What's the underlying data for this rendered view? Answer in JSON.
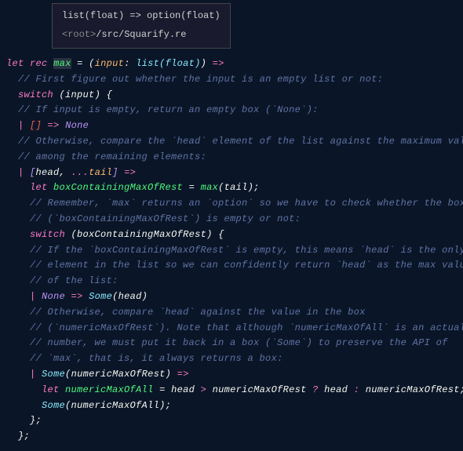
{
  "tooltip": {
    "type_sig": "list(float) => option(float)",
    "path_prefix": "<root>",
    "path": "/src/Squarify.re"
  },
  "code": {
    "l1": {
      "let": "let",
      "rec": "rec",
      "fn": "max",
      "eq": " = (",
      "input": "input",
      "colon": ": ",
      "type": "list(float)",
      "close": ")",
      "arrow": " =>"
    },
    "l2": "// First figure out whether the input is an empty list or not:",
    "l3": {
      "switch": "switch",
      "open": " (",
      "input": "input",
      "close": ") {"
    },
    "l4": "// If input is empty, return an empty box (`None`):",
    "l5": {
      "pipe": "|",
      "empty": " []",
      "arrow": " => ",
      "none": "None"
    },
    "l6": "// Otherwise, compare the `head` element of the list against the maximum value",
    "l7": "// among the remaining elements:",
    "l8": {
      "pipe": "|",
      "ob": " [",
      "head": "head",
      "comma": ", ",
      "spread": "...",
      "tail": "tail",
      "cb": "]",
      "arrow": " =>"
    },
    "l9": {
      "let": "let",
      "var": " boxContainingMaxOfRest",
      "eq": " = ",
      "call": "max",
      "open": "(",
      "arg": "tail",
      "close": ");"
    },
    "l10": "// Remember, `max` returns an `option` so we have to check whether the box",
    "l11": "// (`boxContainingMaxOfRest`) is empty or not:",
    "l12": {
      "switch": "switch",
      "open": " (",
      "var": "boxContainingMaxOfRest",
      "close": ") {"
    },
    "l13": "// If the `boxContainingMaxOfRest` is empty, this means `head` is the only",
    "l14": "// element in the list so we can confidently return `head` as the max value",
    "l15": "// of the list:",
    "l16": {
      "pipe": "|",
      "none": " None",
      "arrow": " => ",
      "some": "Some",
      "open": "(",
      "arg": "head",
      "close": ")"
    },
    "l17": "// Otherwise, compare `head` against the value in the box",
    "l18": "// (`numericMaxOfRest`). Note that although `numericMaxOfAll` is an actual",
    "l19": "// number, we must put it back in a box (`Some`) to preserve the API of",
    "l20": "// `max`, that is, it always returns a box:",
    "l21": {
      "pipe": "|",
      "some": " Some",
      "open": "(",
      "arg": "numericMaxOfRest",
      "close": ")",
      "arrow": " =>"
    },
    "l22": {
      "let": "let",
      "var": " numericMaxOfAll",
      "eq": " = ",
      "head": "head",
      "gt": " > ",
      "rest": "numericMaxOfRest",
      "q": " ? ",
      "head2": "head",
      "colon": " : ",
      "rest2": "numericMaxOfRest",
      "semi": ";"
    },
    "l23": {
      "some": "Some",
      "open": "(",
      "arg": "numericMaxOfAll",
      "close": ");"
    },
    "l24": "};",
    "l25": "};"
  }
}
